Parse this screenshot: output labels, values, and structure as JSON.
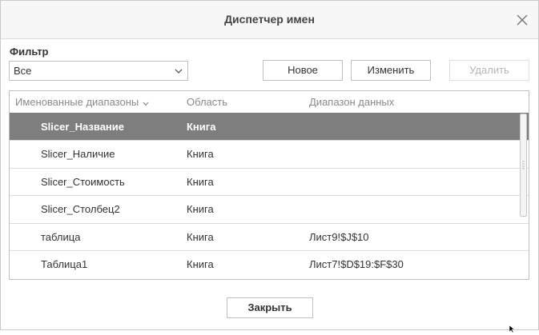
{
  "dialog": {
    "title": "Диспетчер имен",
    "filter_label": "Фильтр",
    "filter_value": "Все",
    "buttons": {
      "new": "Новое",
      "edit": "Изменить",
      "delete": "Удалить",
      "close": "Закрыть"
    }
  },
  "table": {
    "headers": {
      "name": "Именованные диапазоны",
      "scope": "Область",
      "range": "Диапазон данных"
    },
    "rows": [
      {
        "name": "Slicer_Название",
        "scope": "Книга",
        "range": ""
      },
      {
        "name": "Slicer_Наличие",
        "scope": "Книга",
        "range": ""
      },
      {
        "name": "Slicer_Стоимость",
        "scope": "Книга",
        "range": ""
      },
      {
        "name": "Slicer_Столбец2",
        "scope": "Книга",
        "range": ""
      },
      {
        "name": "таблица",
        "scope": "Книга",
        "range": "Лист9!$J$10"
      },
      {
        "name": "Таблица1",
        "scope": "Книга",
        "range": "Лист7!$D$19:$F$30"
      }
    ]
  },
  "icons": {
    "close": "close-icon",
    "dropdown": "chevron-down-icon",
    "sort": "sort-down-icon"
  }
}
